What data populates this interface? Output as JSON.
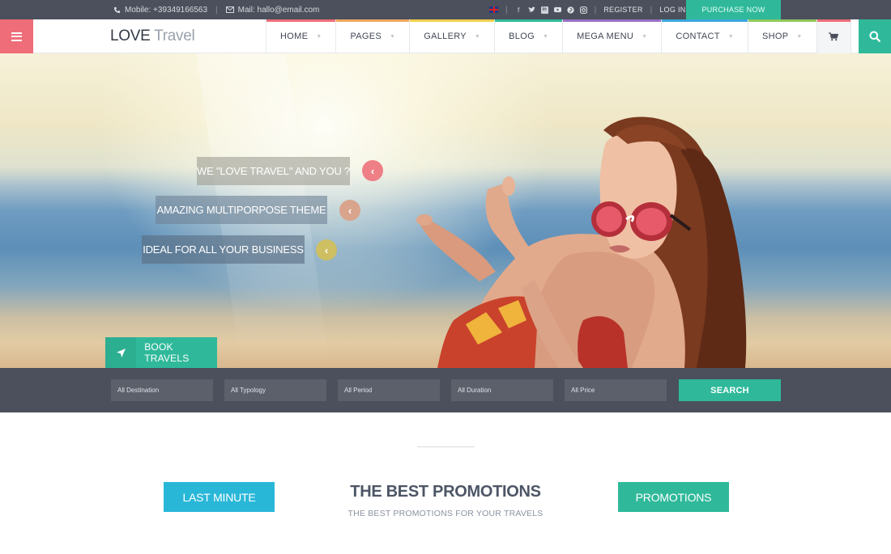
{
  "topbar": {
    "mobile": "Mobile: +39349166563",
    "mail": "Mail: hallo@email.com",
    "separator": "|",
    "register": "REGISTER",
    "login": "LOG IN",
    "purchase": "PURCHASE NOW",
    "social_icons": [
      "facebook-icon",
      "twitter-icon",
      "linkedin-icon",
      "youtube-icon",
      "pinterest-icon",
      "instagram-icon"
    ]
  },
  "header": {
    "logo_bold": "LOVE",
    "logo_light": "Travel",
    "nav": [
      {
        "label": "HOME",
        "color": "#ee6d78"
      },
      {
        "label": "PAGES",
        "color": "#f0a75c"
      },
      {
        "label": "GALLERY",
        "color": "#f2cf4a"
      },
      {
        "label": "BLOG",
        "color": "#2fb99a"
      },
      {
        "label": "MEGA MENU",
        "color": "#9b6fc4"
      },
      {
        "label": "CONTACT",
        "color": "#3aa6dd"
      },
      {
        "label": "SHOP",
        "color": "#8fc85a"
      }
    ],
    "cart_color": "#ee6d78"
  },
  "hero": {
    "captions": [
      "WE \"LOVE TRAVEL\" AND YOU ?",
      "AMAZING MULTIPORPOSE THEME",
      "IDEAL FOR ALL YOUR BUSINESS"
    ],
    "book_label": "BOOK TRAVELS"
  },
  "search": {
    "fields": [
      "All Destination",
      "All Typology",
      "All Period",
      "All Duration",
      "All Price"
    ],
    "button": "SEARCH"
  },
  "promos": {
    "left_button": "LAST MINUTE",
    "title": "THE BEST PROMOTIONS",
    "subtitle": "THE BEST PROMOTIONS FOR YOUR TRAVELS",
    "right_button": "PROMOTIONS"
  },
  "colors": {
    "accent_green": "#2fb99a",
    "accent_pink": "#ee6d78",
    "accent_blue": "#29b7d8",
    "dark_bar": "#4b505c"
  }
}
